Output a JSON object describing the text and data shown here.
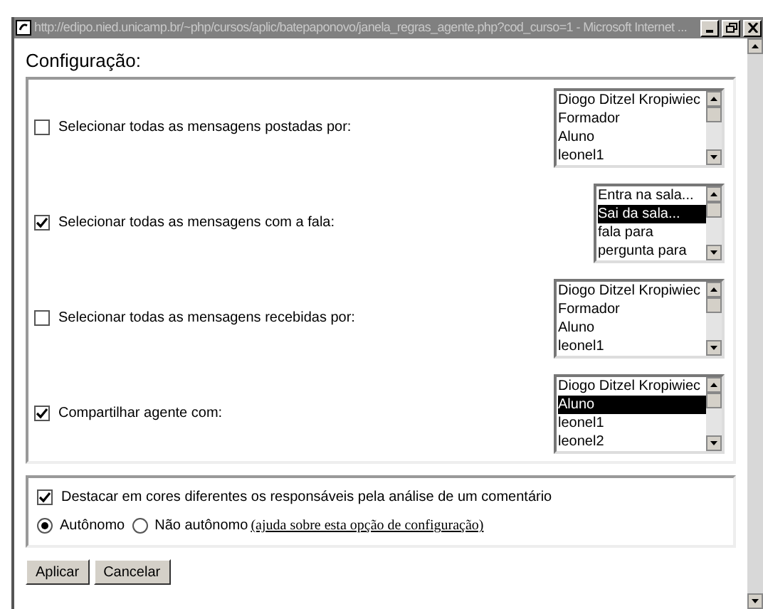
{
  "window": {
    "title": "http://edipo.nied.unicamp.br/~php/cursos/aplic/batepaponovo/janela_regras_agente.php?cod_curso=1 - Microsoft Internet ..."
  },
  "heading": "Configuração:",
  "rules": [
    {
      "label": "Selecionar todas as mensagens postadas por:",
      "checked": false,
      "list": [
        {
          "label": "Diogo Ditzel Kropiwiec",
          "selected": false
        },
        {
          "label": "Formador",
          "selected": false
        },
        {
          "label": "Aluno",
          "selected": false
        },
        {
          "label": "leonel1",
          "selected": false
        }
      ]
    },
    {
      "label": "Selecionar todas as mensagens com a fala:",
      "checked": true,
      "list": [
        {
          "label": "Entra na sala...",
          "selected": false
        },
        {
          "label": "Sai da sala...",
          "selected": true
        },
        {
          "label": "fala para",
          "selected": false
        },
        {
          "label": "pergunta para",
          "selected": false
        }
      ]
    },
    {
      "label": "Selecionar todas as mensagens recebidas por:",
      "checked": false,
      "list": [
        {
          "label": "Diogo Ditzel Kropiwiec",
          "selected": false
        },
        {
          "label": "Formador",
          "selected": false
        },
        {
          "label": "Aluno",
          "selected": false
        },
        {
          "label": "leonel1",
          "selected": false
        }
      ]
    },
    {
      "label": "Compartilhar agente com:",
      "checked": true,
      "list": [
        {
          "label": "Diogo Ditzel Kropiwiec",
          "selected": false
        },
        {
          "label": "Aluno",
          "selected": true
        },
        {
          "label": "leonel1",
          "selected": false
        },
        {
          "label": "leonel2",
          "selected": false
        }
      ]
    }
  ],
  "highlight": {
    "label": "Destacar em cores diferentes os responsáveis pela análise de um comentário",
    "checked": true
  },
  "modes": [
    {
      "label": "Autônomo",
      "selected": true
    },
    {
      "label": "Não autônomo",
      "selected": false
    }
  ],
  "help_link": "(ajuda sobre esta opção de configuração)",
  "buttons": [
    "Aplicar",
    "Cancelar"
  ]
}
